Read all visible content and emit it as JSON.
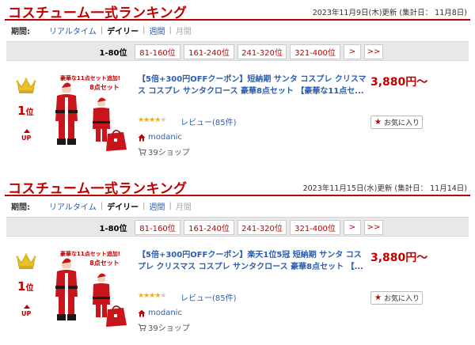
{
  "colors": {
    "accent": "#bf0000",
    "link": "#2a5db0",
    "star": "#f5a623"
  },
  "panels": [
    {
      "title": "コスチューム一式ランキング",
      "date": "2023年11月9日(木)更新 (集計日： 11月8日)",
      "period": {
        "label": "期間:",
        "items": [
          "リアルタイム",
          "デイリー",
          "週間",
          "月間"
        ],
        "active": "デイリー"
      },
      "ranges": {
        "current": "1-80位",
        "links": [
          "81-160位",
          "161-240位",
          "241-320位",
          "321-400位",
          ">",
          ">>"
        ]
      },
      "item": {
        "rank": "1",
        "rank_suffix": "位",
        "trend": "UP",
        "title": "【5倍+300円OFFクーポン】短納期 サンタ コスプレ クリスマス コスプレ サンタクロース 豪華8点セット 【豪華な11点セ...",
        "price": "3,880円～",
        "rating": 4,
        "review": "レビュー(85件)",
        "shop": "modanic",
        "points": "39ショップ",
        "favorite": "お気に入り",
        "badge_top": "豪華な11点セット追加!",
        "badge_bottom": "8点セット"
      }
    },
    {
      "title": "コスチューム一式ランキング",
      "date": "2023年11月15日(水)更新 (集計日： 11月14日)",
      "period": {
        "label": "期間:",
        "items": [
          "リアルタイム",
          "デイリー",
          "週間",
          "月間"
        ],
        "active": "デイリー"
      },
      "ranges": {
        "current": "1-80位",
        "links": [
          "81-160位",
          "161-240位",
          "241-320位",
          "321-400位",
          ">",
          ">>"
        ]
      },
      "item": {
        "rank": "1",
        "rank_suffix": "位",
        "trend": "UP",
        "title": "【5倍+300円OFFクーポン】楽天1位5冠 短納期 サンタ コスプレ クリスマス コスプレ サンタクロース 豪華8点セット 【...",
        "price": "3,880円～",
        "rating": 4,
        "review": "レビュー(85件)",
        "shop": "modanic",
        "points": "39ショップ",
        "favorite": "お気に入り",
        "badge_top": "豪華な11点セット追加!",
        "badge_bottom": "8点セット"
      }
    }
  ]
}
